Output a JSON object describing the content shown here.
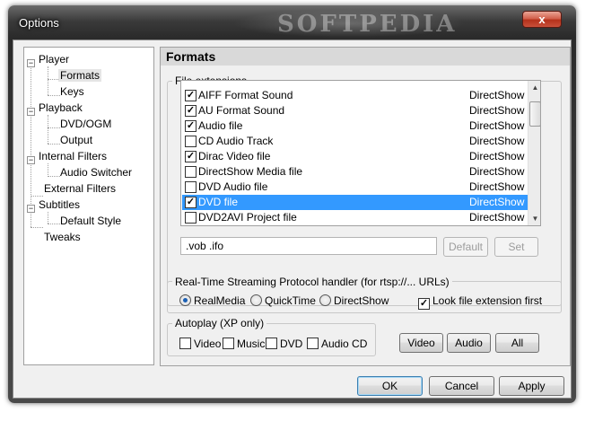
{
  "window": {
    "title": "Options",
    "watermark": "SOFTPEDIA",
    "close_label": "x"
  },
  "tree": [
    {
      "label": "Player",
      "expanded": true
    },
    {
      "label": "Formats",
      "selected": true
    },
    {
      "label": "Keys"
    },
    {
      "label": "Playback",
      "expanded": true
    },
    {
      "label": "DVD/OGM"
    },
    {
      "label": "Output"
    },
    {
      "label": "Internal Filters",
      "expanded": true
    },
    {
      "label": "Audio Switcher"
    },
    {
      "label": "External Filters"
    },
    {
      "label": "Subtitles",
      "expanded": true
    },
    {
      "label": "Default Style"
    },
    {
      "label": "Tweaks"
    }
  ],
  "panel": {
    "title": "Formats",
    "file_extensions_label": "File extensions",
    "files": [
      {
        "name": "AIFF Format Sound",
        "handler": "DirectShow",
        "checked": true
      },
      {
        "name": "AU Format Sound",
        "handler": "DirectShow",
        "checked": true
      },
      {
        "name": "Audio file",
        "handler": "DirectShow",
        "checked": true
      },
      {
        "name": "CD Audio Track",
        "handler": "DirectShow",
        "checked": false
      },
      {
        "name": "Dirac Video file",
        "handler": "DirectShow",
        "checked": true
      },
      {
        "name": "DirectShow Media file",
        "handler": "DirectShow",
        "checked": false
      },
      {
        "name": "DVD Audio file",
        "handler": "DirectShow",
        "checked": false
      },
      {
        "name": "DVD file",
        "handler": "DirectShow",
        "checked": true,
        "selected": true
      },
      {
        "name": "DVD2AVI Project file",
        "handler": "DirectShow",
        "checked": false
      }
    ],
    "extensions_value": ".vob .ifo",
    "default_label": "Default",
    "set_label": "Set",
    "rtsp": {
      "label": "Real-Time Streaming Protocol handler (for rtsp://... URLs)",
      "options": [
        "RealMedia",
        "QuickTime",
        "DirectShow"
      ],
      "selected": "RealMedia",
      "look_ext_label": "Look file extension first",
      "look_ext_checked": true
    },
    "autoplay": {
      "label": "Autoplay (XP only)",
      "options": [
        {
          "label": "Video",
          "checked": false
        },
        {
          "label": "Music",
          "checked": false
        },
        {
          "label": "DVD",
          "checked": false
        },
        {
          "label": "Audio CD",
          "checked": false
        }
      ]
    },
    "type_buttons": [
      "Video",
      "Audio",
      "All"
    ]
  },
  "footer": {
    "ok": "OK",
    "cancel": "Cancel",
    "apply": "Apply"
  },
  "colors": {
    "selection": "#3399ff",
    "close_button": "#c9503a"
  }
}
